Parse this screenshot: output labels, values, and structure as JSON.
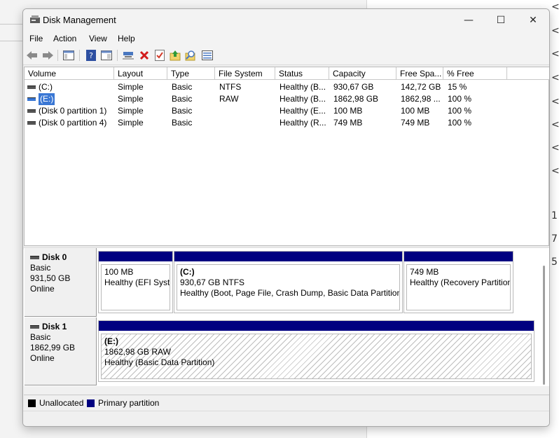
{
  "background_glyphs": [
    "<",
    "<",
    "<",
    "<",
    "<",
    "<",
    "<",
    "<",
    "1",
    "7",
    "5"
  ],
  "window": {
    "title": "Disk Management",
    "minimize_label": "—",
    "maximize_label": "☐",
    "close_label": "✕"
  },
  "menu": [
    "File",
    "Action",
    "View",
    "Help"
  ],
  "toolbar": [
    "back-icon",
    "forward-icon",
    "console-tree-icon",
    "help-icon",
    "properties-icon",
    "connect-icon",
    "delete-icon",
    "check-icon",
    "import-icon",
    "search-icon",
    "list-icon"
  ],
  "volume_table": {
    "columns": [
      "Volume",
      "Layout",
      "Type",
      "File System",
      "Status",
      "Capacity",
      "Free Spa...",
      "% Free"
    ],
    "rows": [
      [
        "(C:)",
        "Simple",
        "Basic",
        "NTFS",
        "Healthy (B...",
        "930,67 GB",
        "142,72 GB",
        "15 %"
      ],
      [
        "(E:)",
        "Simple",
        "Basic",
        "RAW",
        "Healthy (B...",
        "1862,98 GB",
        "1862,98 ...",
        "100 %"
      ],
      [
        "(Disk 0 partition 1)",
        "Simple",
        "Basic",
        "",
        "Healthy (E...",
        "100 MB",
        "100 MB",
        "100 %"
      ],
      [
        "(Disk 0 partition 4)",
        "Simple",
        "Basic",
        "",
        "Healthy (R...",
        "749 MB",
        "749 MB",
        "100 %"
      ]
    ],
    "selected_row": 1
  },
  "disks": [
    {
      "name": "Disk 0",
      "type": "Basic",
      "size": "931,50 GB",
      "state": "Online",
      "partitions": [
        {
          "title": "",
          "line1": "100 MB",
          "line2": "Healthy (EFI Syste"
        },
        {
          "title": "(C:)",
          "line1": "930,67 GB NTFS",
          "line2": "Healthy (Boot, Page File, Crash Dump, Basic Data Partition)"
        },
        {
          "title": "",
          "line1": "749 MB",
          "line2": "Healthy (Recovery Partition"
        }
      ]
    },
    {
      "name": "Disk 1",
      "type": "Basic",
      "size": "1862,99 GB",
      "state": "Online",
      "partitions": [
        {
          "title": "(E:)",
          "line1": "1862,98 GB RAW",
          "line2": "Healthy (Basic Data Partition)"
        }
      ]
    }
  ],
  "legend": {
    "unallocated": "Unallocated",
    "primary": "Primary partition",
    "unallocated_color": "#000000",
    "primary_color": "#000080"
  }
}
